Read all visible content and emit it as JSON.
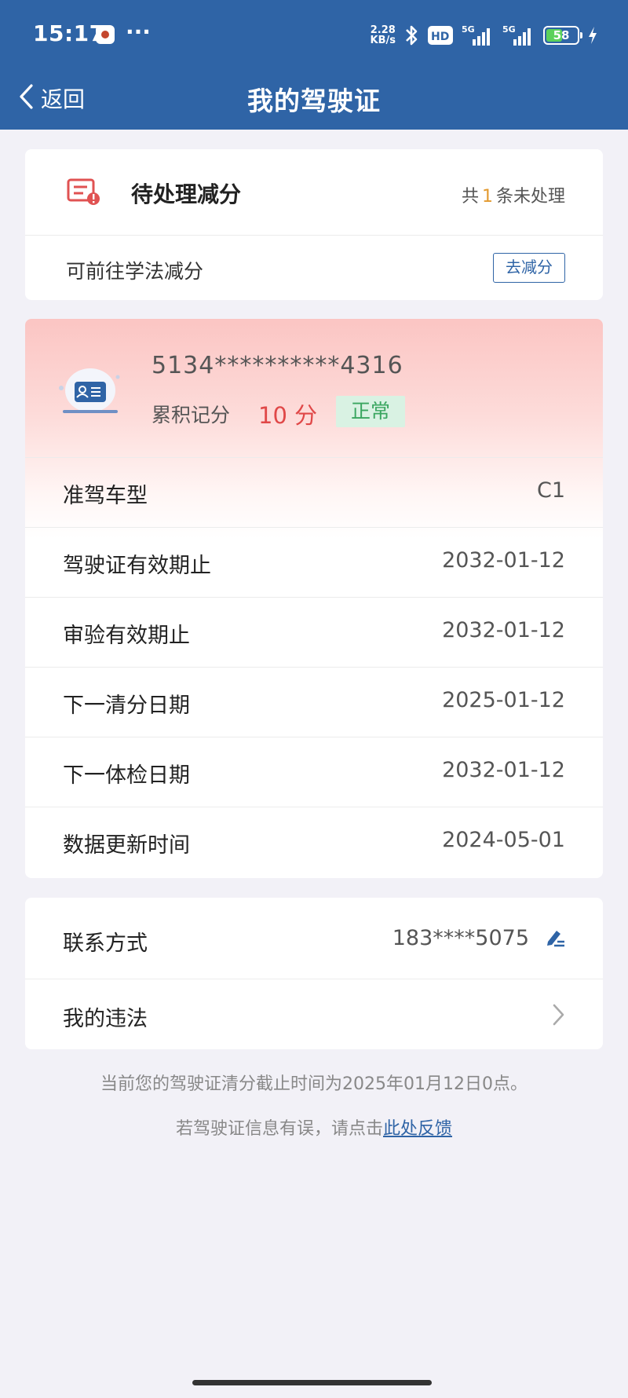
{
  "status_bar": {
    "time": "15:17",
    "dots": "···",
    "net_speed_value": "2.28",
    "net_speed_unit": "KB/s",
    "network_1": "5G",
    "network_2": "5G",
    "battery": "58",
    "battery_level_percent": 58,
    "icons": [
      "app-notification-icon",
      "bluetooth-icon",
      "hd-icon",
      "signal-icon",
      "charging-icon"
    ]
  },
  "nav": {
    "back_label": "返回",
    "title": "我的驾驶证"
  },
  "pending": {
    "title": "待处理减分",
    "count_prefix": "共",
    "count": "1",
    "count_suffix": "条未处理",
    "study_text": "可前往学法减分",
    "reduce_button": "去减分",
    "icon_color": "#e05252"
  },
  "license": {
    "number": "5134**********4316",
    "score_label": "累积记分",
    "score_value": "10 分",
    "status": "正常",
    "rows": [
      {
        "key": "准驾车型",
        "value": "C1"
      },
      {
        "key": "驾驶证有效期止",
        "value": "2032-01-12"
      },
      {
        "key": "审验有效期止",
        "value": "2032-01-12"
      },
      {
        "key": "下一清分日期",
        "value": "2025-01-12"
      },
      {
        "key": "下一体检日期",
        "value": "2032-01-12"
      },
      {
        "key": "数据更新时间",
        "value": "2024-05-01"
      }
    ]
  },
  "contact": {
    "label": "联系方式",
    "phone": "183****5075",
    "violations_label": "我的违法"
  },
  "notices": {
    "clear_deadline": "当前您的驾驶证清分截止时间为2025年01月12日0点。",
    "feedback_prefix": "若驾驶证信息有误，请点击",
    "feedback_link": "此处反馈"
  },
  "colors": {
    "header": "#2f64a6",
    "accent_blue": "#2f64a6",
    "score_red": "#e04848",
    "status_green": "#3aa660",
    "count_orange": "#e39a2f"
  }
}
